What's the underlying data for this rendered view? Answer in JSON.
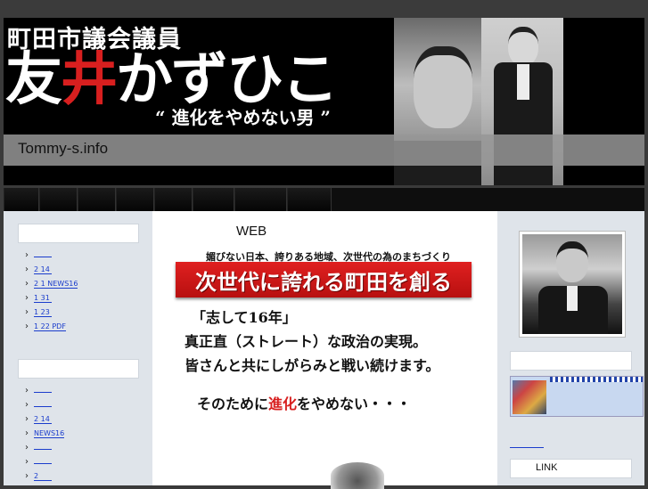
{
  "header": {
    "title_line": "町田市議会議員",
    "name_part1": "友",
    "name_part2": "井",
    "name_part3": "かずひこ",
    "slogan": "“ 進化をやめない男 ”",
    "site_url": "Tommy-s.info"
  },
  "nav": {
    "button_count": 8
  },
  "left_sidebar": {
    "list1": [
      "",
      "2 14",
      "2 1  NEWS16",
      "1 31",
      "1 23",
      "1 22                PDF"
    ],
    "list2": [
      "",
      "",
      "2 14",
      "     NEWS16",
      "",
      "",
      "2"
    ]
  },
  "main": {
    "web_label": "WEB",
    "tagline": "媚びない日本、誇りある地域、次世代の為のまちづくり",
    "banner": "次世代に誇れる町田を創る",
    "message1": "「志して16年」",
    "message2": "真正直（ストレート）な政治の実現。",
    "message3": "皆さんと共にしがらみと戦い続けます。",
    "message4_a": "そのために",
    "message4_b": "進化",
    "message4_c": "をやめない・・・"
  },
  "right_sidebar": {
    "link_label": "LINK"
  },
  "colors": {
    "accent_red": "#d81f1f",
    "link_blue": "#1a3ccc",
    "sidebar_bg": "#dfe4ea"
  }
}
